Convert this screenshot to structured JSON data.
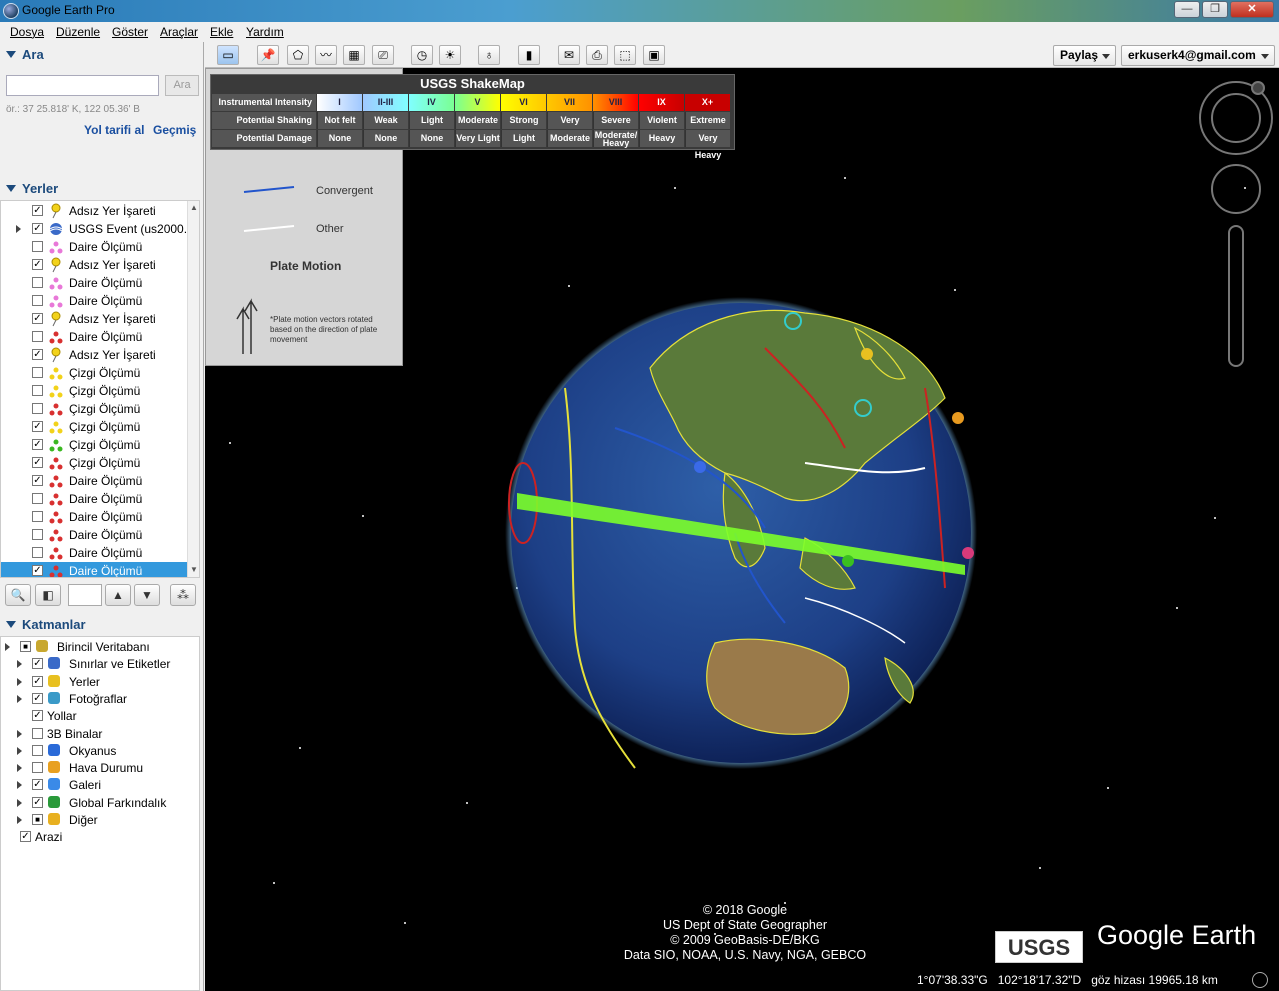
{
  "window": {
    "title": "Google Earth Pro",
    "buttons": {
      "minimize": "—",
      "maximize": "❐",
      "close": "✕"
    }
  },
  "menu": [
    "Dosya",
    "Düzenle",
    "Göster",
    "Araçlar",
    "Ekle",
    "Yardım"
  ],
  "search": {
    "header": "Ara",
    "input_value": "",
    "button": "Ara",
    "hint": "ör.: 37 25.818' K, 122 05.36' B",
    "directions_link": "Yol tarifi al",
    "history_link": "Geçmiş"
  },
  "places": {
    "header": "Yerler",
    "items": [
      {
        "label": "Adsız Yer İşareti",
        "checked": true,
        "icon": "yellow-pushpin-icon"
      },
      {
        "label": "USGS Event (us2000...",
        "checked": true,
        "icon": "usgs-globe-icon",
        "expandable": true
      },
      {
        "label": "Daire Ölçümü",
        "checked": false,
        "icon": "pink-measure-icon"
      },
      {
        "label": "Adsız Yer İşareti",
        "checked": true,
        "icon": "yellow-pushpin-icon"
      },
      {
        "label": "Daire Ölçümü",
        "checked": false,
        "icon": "pink-measure-icon"
      },
      {
        "label": "Daire Ölçümü",
        "checked": false,
        "icon": "pink-measure-icon"
      },
      {
        "label": "Adsız Yer İşareti",
        "checked": true,
        "icon": "yellow-pushpin-icon"
      },
      {
        "label": "Daire Ölçümü",
        "checked": false,
        "icon": "red-measure-icon"
      },
      {
        "label": "Adsız Yer İşareti",
        "checked": true,
        "icon": "yellow-pushpin-icon"
      },
      {
        "label": "Çizgi Ölçümü",
        "checked": false,
        "icon": "yellow-measure-icon"
      },
      {
        "label": "Çizgi Ölçümü",
        "checked": false,
        "icon": "yellow-measure-icon"
      },
      {
        "label": "Çizgi Ölçümü",
        "checked": false,
        "icon": "red-measure-icon"
      },
      {
        "label": "Çizgi Ölçümü",
        "checked": true,
        "icon": "yellow-measure-icon"
      },
      {
        "label": "Çizgi Ölçümü",
        "checked": true,
        "icon": "green-measure-icon"
      },
      {
        "label": "Çizgi Ölçümü",
        "checked": true,
        "icon": "red-measure-icon"
      },
      {
        "label": "Daire Ölçümü",
        "checked": true,
        "icon": "red-measure-icon"
      },
      {
        "label": "Daire Ölçümü",
        "checked": false,
        "icon": "red-measure-icon"
      },
      {
        "label": "Daire Ölçümü",
        "checked": false,
        "icon": "red-measure-icon"
      },
      {
        "label": "Daire Ölçümü",
        "checked": false,
        "icon": "red-measure-icon"
      },
      {
        "label": "Daire Ölçümü",
        "checked": false,
        "icon": "red-measure-icon"
      },
      {
        "label": "Daire Ölçümü",
        "checked": true,
        "icon": "red-measure-icon",
        "selected": true
      }
    ]
  },
  "layers": {
    "header": "Katmanlar",
    "items": [
      {
        "label": "Birincil Veritabanı",
        "checked": "partial",
        "icon": "database-icon",
        "level": 0,
        "expandable": true
      },
      {
        "label": "Sınırlar ve Etiketler",
        "checked": true,
        "icon": "flag-icon",
        "level": 1,
        "expandable": true
      },
      {
        "label": "Yerler",
        "checked": true,
        "icon": "places-icon",
        "level": 1,
        "expandable": true
      },
      {
        "label": "Fotoğraflar",
        "checked": true,
        "icon": "photo-icon",
        "level": 1,
        "expandable": true
      },
      {
        "label": "Yollar",
        "checked": true,
        "icon": "",
        "level": 1,
        "expandable": false
      },
      {
        "label": "3B Binalar",
        "checked": false,
        "icon": "",
        "level": 1,
        "expandable": true
      },
      {
        "label": "Okyanus",
        "checked": false,
        "icon": "ocean-icon",
        "level": 1,
        "expandable": true
      },
      {
        "label": "Hava Durumu",
        "checked": false,
        "icon": "weather-icon",
        "level": 1,
        "expandable": true
      },
      {
        "label": "Galeri",
        "checked": true,
        "icon": "gallery-star-icon",
        "level": 1,
        "expandable": true
      },
      {
        "label": "Global Farkındalık",
        "checked": true,
        "icon": "globe-icon",
        "level": 1,
        "expandable": true
      },
      {
        "label": "Diğer",
        "checked": "partial",
        "icon": "folder-icon",
        "level": 1,
        "expandable": true
      },
      {
        "label": "Arazi",
        "checked": true,
        "icon": "",
        "level": 0,
        "expandable": false
      }
    ]
  },
  "toolbar": {
    "share": "Paylaş",
    "account": "erkuserk4@gmail.com"
  },
  "legend": {
    "convergent": "Convergent",
    "other": "Other",
    "plate_motion": "Plate Motion",
    "note": "*Plate motion vectors rotated based on the direction of plate movement"
  },
  "shakemap": {
    "title": "USGS ShakeMap",
    "row_labels": [
      "Instrumental Intensity",
      "Potential Shaking",
      "Potential Damage"
    ],
    "intensity": [
      "I",
      "II-III",
      "IV",
      "V",
      "VI",
      "VII",
      "VIII",
      "IX",
      "X+"
    ],
    "colors": [
      "#ffffff",
      "#a0c8ff",
      "#80ffff",
      "#7aff93",
      "#ffff00",
      "#ffc800",
      "#ff9100",
      "#ff0000",
      "#c80000"
    ],
    "shaking": [
      "Not felt",
      "Weak",
      "Light",
      "Moderate",
      "Strong",
      "Very Strong",
      "Severe",
      "Violent",
      "Extreme"
    ],
    "damage": [
      "None",
      "None",
      "None",
      "Very Light",
      "Light",
      "Moderate",
      "Moderate/ Heavy",
      "Heavy",
      "Very Heavy"
    ]
  },
  "credits": [
    "© 2018 Google",
    "US Dept of State Geographer",
    "© 2009 GeoBasis-DE/BKG",
    "Data SIO, NOAA, U.S. Navy, NGA, GEBCO"
  ],
  "logos": {
    "usgs": "USGS",
    "google_earth": "Google Earth"
  },
  "status": {
    "lat": "1°07'38.33\"G",
    "lon": "102°18'17.32\"D",
    "eye_alt": "göz hizası 19965.18 km"
  }
}
